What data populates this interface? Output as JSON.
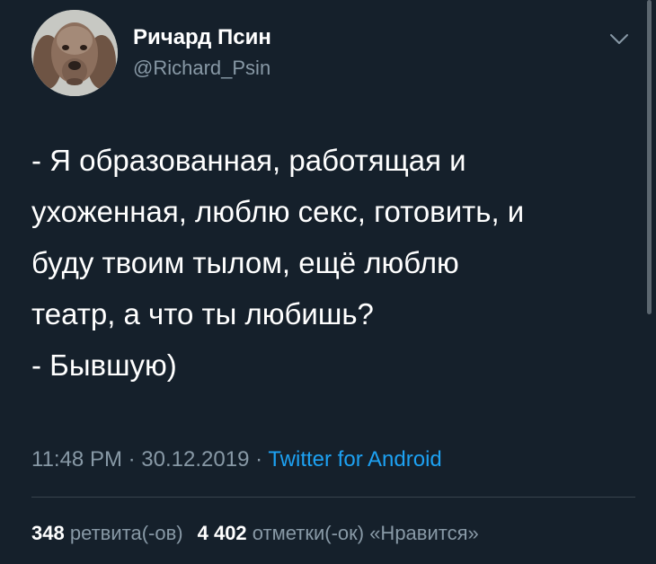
{
  "author": {
    "display_name": "Ричард Псин",
    "handle": "@Richard_Psin",
    "avatar_icon": "dog-avatar"
  },
  "tweet": {
    "lines": [
      "- Я образованная, работящая и",
      "ухоженная, люблю секс, готовить, и",
      "буду твоим тылом, ещё люблю",
      "театр, а что ты любишь?",
      "- Бывшую)"
    ],
    "time": "11:48 PM",
    "separator": "·",
    "date": "30.12.2019",
    "source": "Twitter for Android"
  },
  "stats": {
    "retweets_count": "348",
    "retweets_label": "ретвита(-ов)",
    "likes_count": "4 402",
    "likes_label": "отметки(-ок) «Нравится»"
  },
  "colors": {
    "background": "#15202b",
    "secondary_text": "#8899a6",
    "accent": "#1da1f2"
  }
}
